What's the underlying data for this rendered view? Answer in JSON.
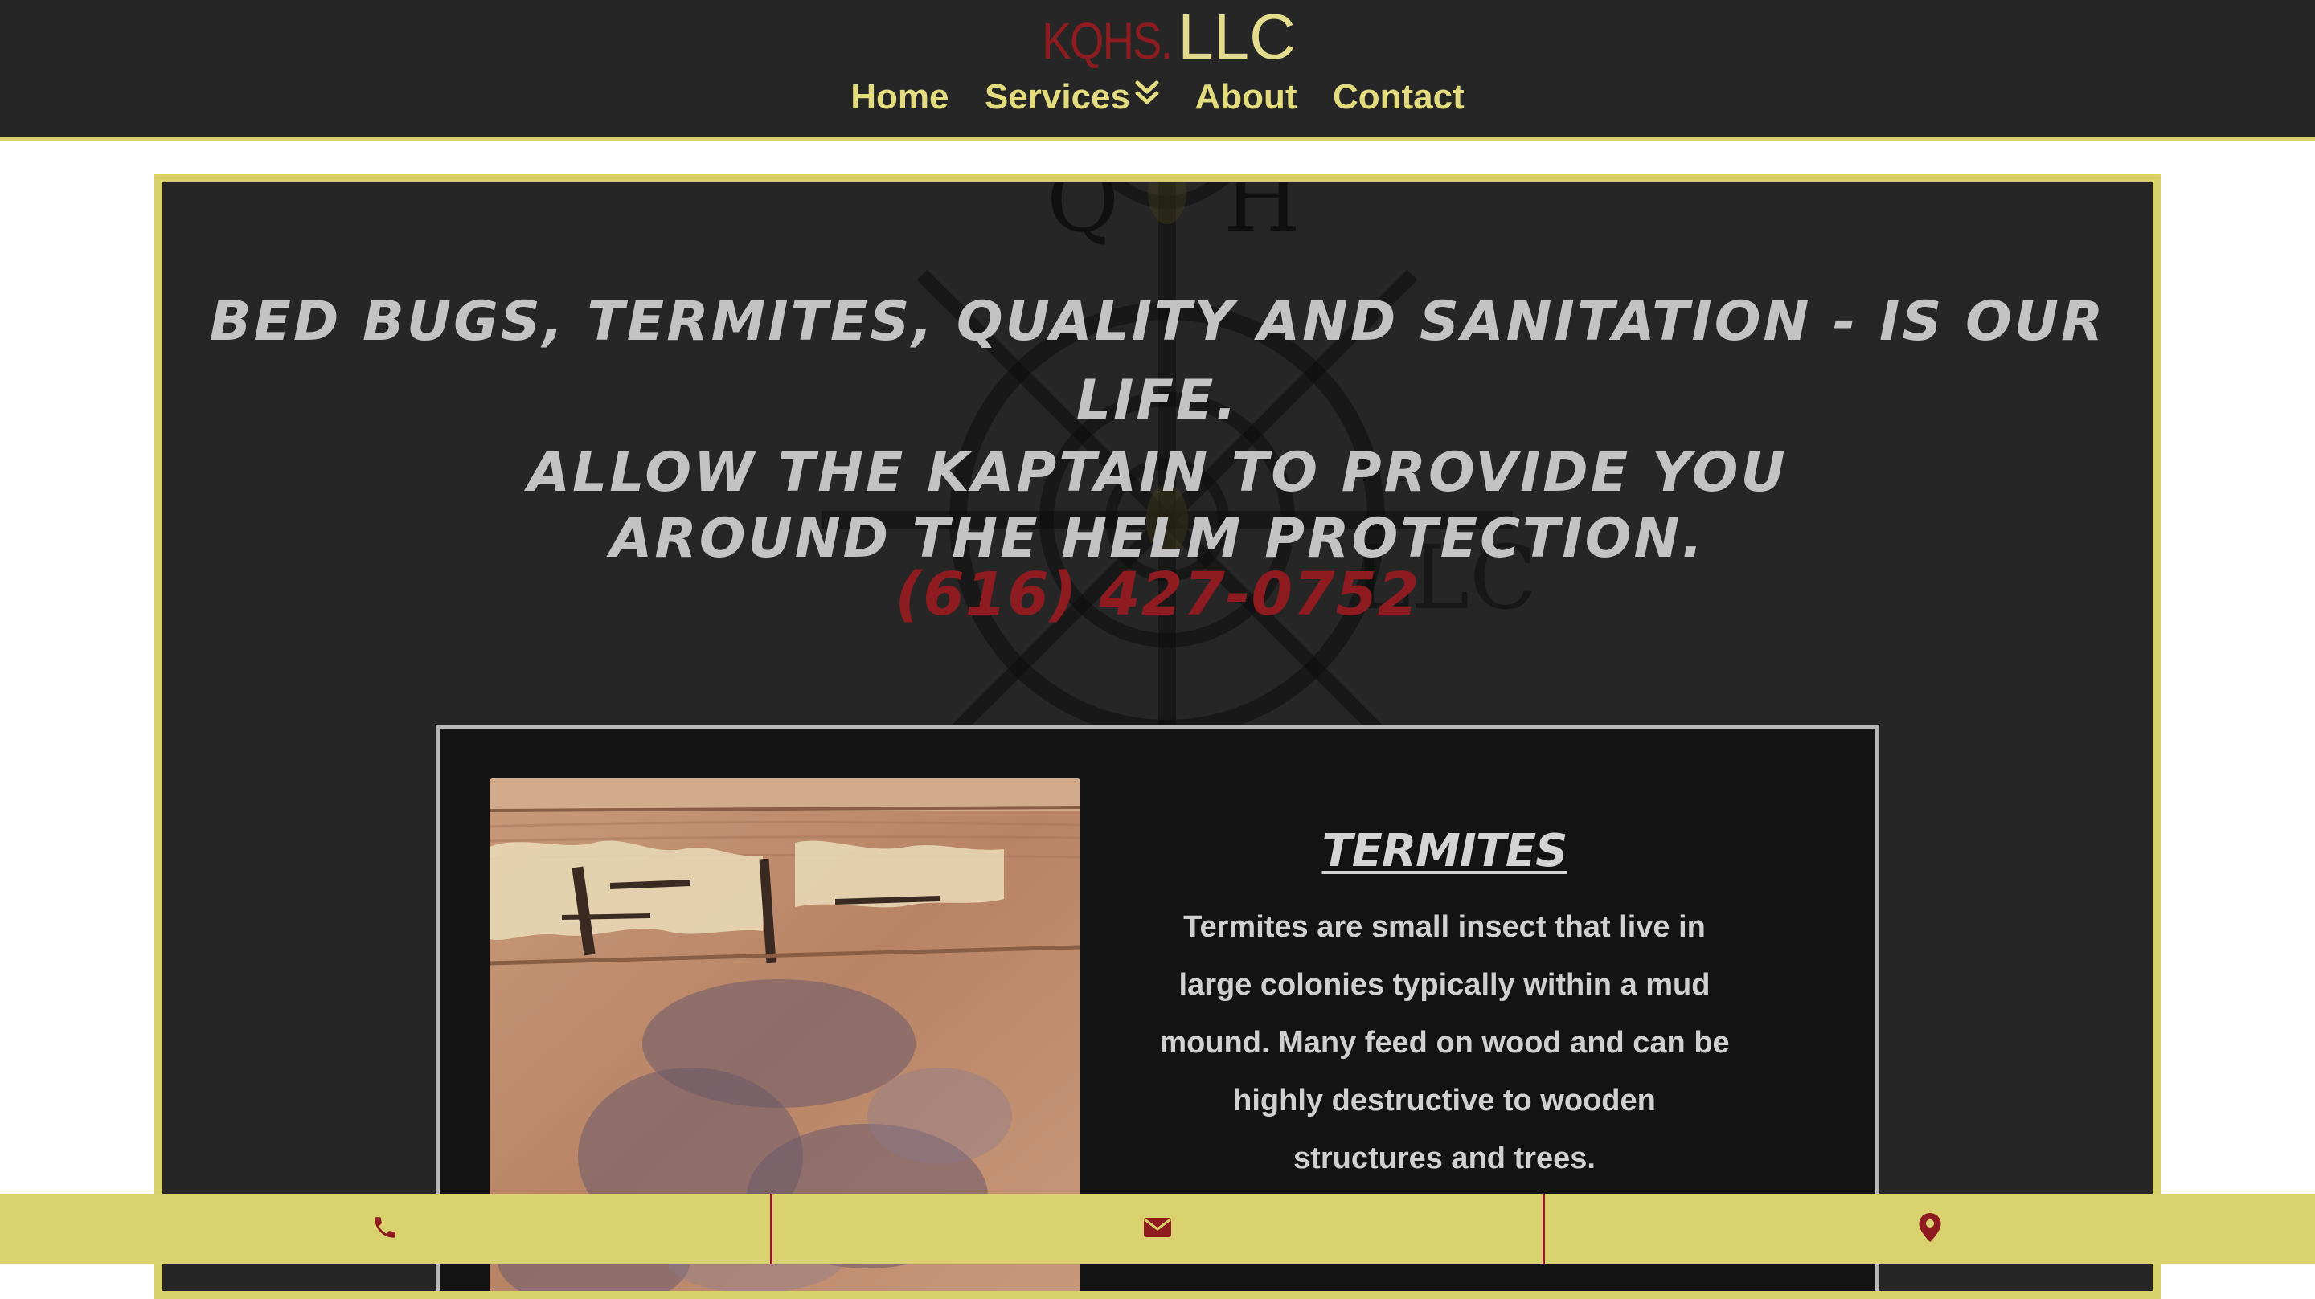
{
  "header": {
    "brand_prefix": "KQHS.",
    "brand_suffix": "LLC"
  },
  "nav": {
    "items": [
      {
        "label": "Home"
      },
      {
        "label": "Services",
        "icon": "double-chevron-down-icon"
      },
      {
        "label": "About"
      },
      {
        "label": "Contact"
      }
    ]
  },
  "hero": {
    "headline_line1": "BED BUGS, TERMITES, QUALITY AND SANITATION - IS OUR LIFE.",
    "headline_line2": "ALLOW THE KAPTAIN TO PROVIDE YOU AROUND THE HELM PROTECTION.",
    "phone": "(616) 427-0752"
  },
  "service_card": {
    "title": "TERMITES",
    "body": "Termites are small insect that live in large colonies typically within a mud mound. Many feed on wood and can be highly destructive to wooden structures and trees.",
    "image_description_icon": "termite-damaged-wood-photo"
  },
  "bottom_bar": {
    "buttons": [
      {
        "icon": "phone-icon"
      },
      {
        "icon": "envelope-icon"
      },
      {
        "icon": "map-marker-icon"
      }
    ]
  },
  "colors": {
    "header_bg": "#262626",
    "accent_yellow": "#d8d06a",
    "nav_text": "#e3dc7e",
    "brand_red": "#8e1b1f",
    "hero_bg": "#262626",
    "headline_text": "#c3c3c3",
    "card_bg": "#131313",
    "bottom_bar_bg": "#d9d26f"
  }
}
